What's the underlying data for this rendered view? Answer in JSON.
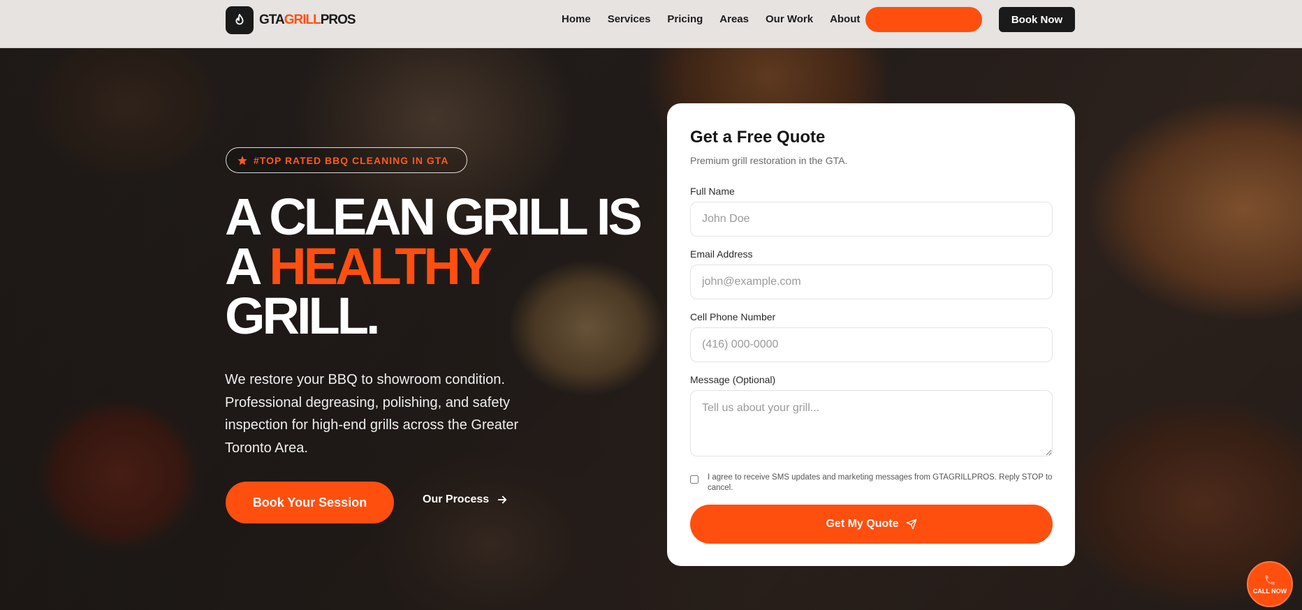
{
  "header": {
    "logo": {
      "prefix": "GTA",
      "accent": "GRILL",
      "suffix": "PROS"
    },
    "nav": [
      "Home",
      "Services",
      "Pricing",
      "Areas",
      "Our Work",
      "About"
    ],
    "book_now_label": "Book Now"
  },
  "hero": {
    "badge": "#TOP RATED BBQ CLEANING IN GTA",
    "headline": {
      "line1": "A CLEAN GRILL IS",
      "line2_prefix": "A ",
      "line2_accent": "HEALTHY",
      "line3": "GRILL."
    },
    "subtext": "We restore your BBQ to showroom condition. Professional degreasing, polishing, and safety inspection for high-end grills across the Greater Toronto Area.",
    "primary_cta": "Book Your Session",
    "secondary_cta": "Our Process"
  },
  "quote_form": {
    "title": "Get a Free Quote",
    "subtitle": "Premium grill restoration in the GTA.",
    "full_name": {
      "label": "Full Name",
      "placeholder": "John Doe"
    },
    "email": {
      "label": "Email Address",
      "placeholder": "john@example.com"
    },
    "phone": {
      "label": "Cell Phone Number",
      "placeholder": "(416) 000-0000"
    },
    "message": {
      "label": "Message (Optional)",
      "placeholder": "Tell us about your grill..."
    },
    "consent": "I agree to receive SMS updates and marketing messages from GTAGRILLPROS. Reply STOP to cancel.",
    "submit_label": "Get My Quote"
  },
  "floating": {
    "call_label": "CALL NOW"
  },
  "colors": {
    "accent": "#ff4f0f",
    "dark": "#1a1a1a",
    "header_bg": "#e6e3e1"
  }
}
